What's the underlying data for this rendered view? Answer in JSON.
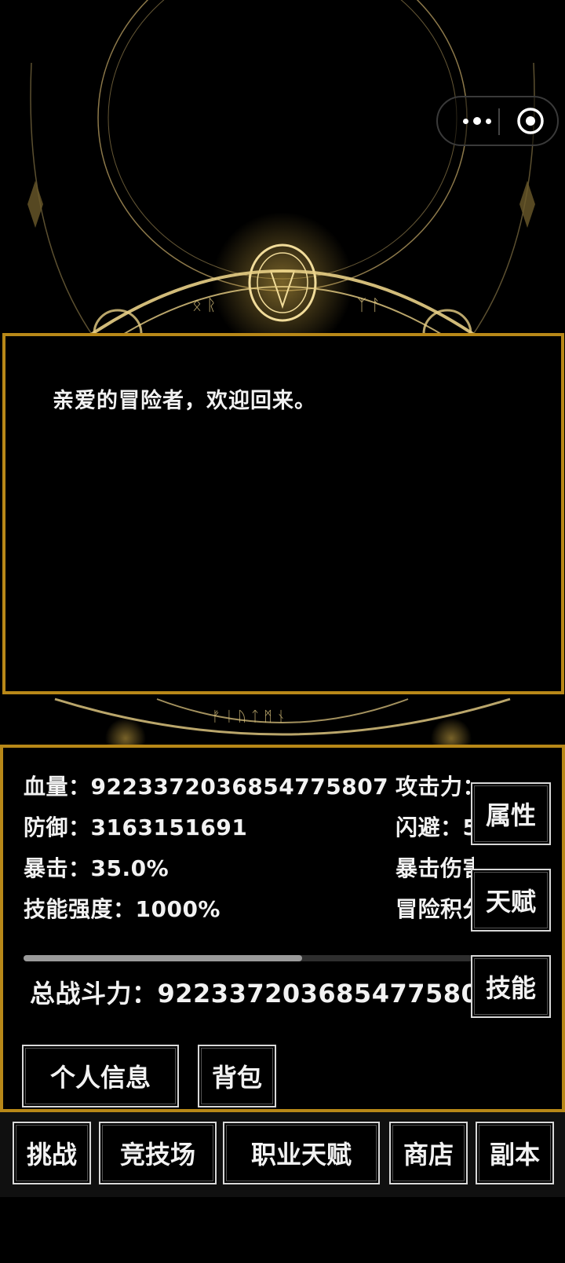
{
  "capsule": {
    "more_icon": "more-dots-icon",
    "close_icon": "target-circle-icon"
  },
  "message": {
    "text": "亲爱的冒险者，欢迎回来。"
  },
  "stats": {
    "hp": "血量：9223372036854775807",
    "defense": "防御：3163151691",
    "crit": "暴击：35.0%",
    "skill_power": "技能强度：1000%",
    "attack": "攻击力：",
    "dodge": "闪避：5",
    "crit_damage": "暴击伤害",
    "adventure_points": "冒险积分"
  },
  "progress": {
    "fraction": 0.62
  },
  "power": "总战斗力：9223372036854775807",
  "side_buttons": {
    "attributes": "属性",
    "talent": "天赋",
    "skills": "技能"
  },
  "action_buttons": {
    "profile": "个人信息",
    "bag": "背包"
  },
  "nav": {
    "challenge": "挑战",
    "arena": "竞技场",
    "class_talent": "职业天赋",
    "shop": "商店",
    "dungeon": "副本"
  },
  "colors": {
    "border_gold": "#b88818",
    "glow_gold": "#d9b24a",
    "background": "#000000"
  }
}
